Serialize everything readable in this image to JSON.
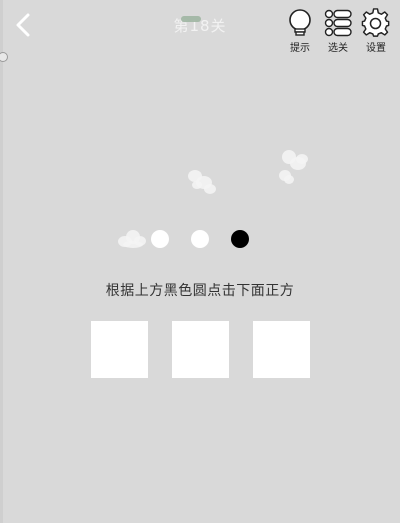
{
  "header": {
    "level_title": "第18关",
    "back_icon": "chevron-left-icon"
  },
  "toolbar": {
    "hint_label": "提示",
    "hint_icon": "lightbulb-icon",
    "levels_label": "选关",
    "levels_icon": "list-icon",
    "settings_label": "设置",
    "settings_icon": "gear-icon"
  },
  "puzzle": {
    "circles": [
      {
        "color": "#ffffff"
      },
      {
        "color": "#ffffff"
      },
      {
        "color": "#000000"
      }
    ],
    "instruction": "根据上方黑色圆点击下面正方",
    "squares": [
      {
        "color": "#ffffff"
      },
      {
        "color": "#ffffff"
      },
      {
        "color": "#ffffff"
      }
    ]
  },
  "colors": {
    "background": "#d9d9d9",
    "title_text": "#f2f2f2",
    "instruction_text": "#333333"
  }
}
